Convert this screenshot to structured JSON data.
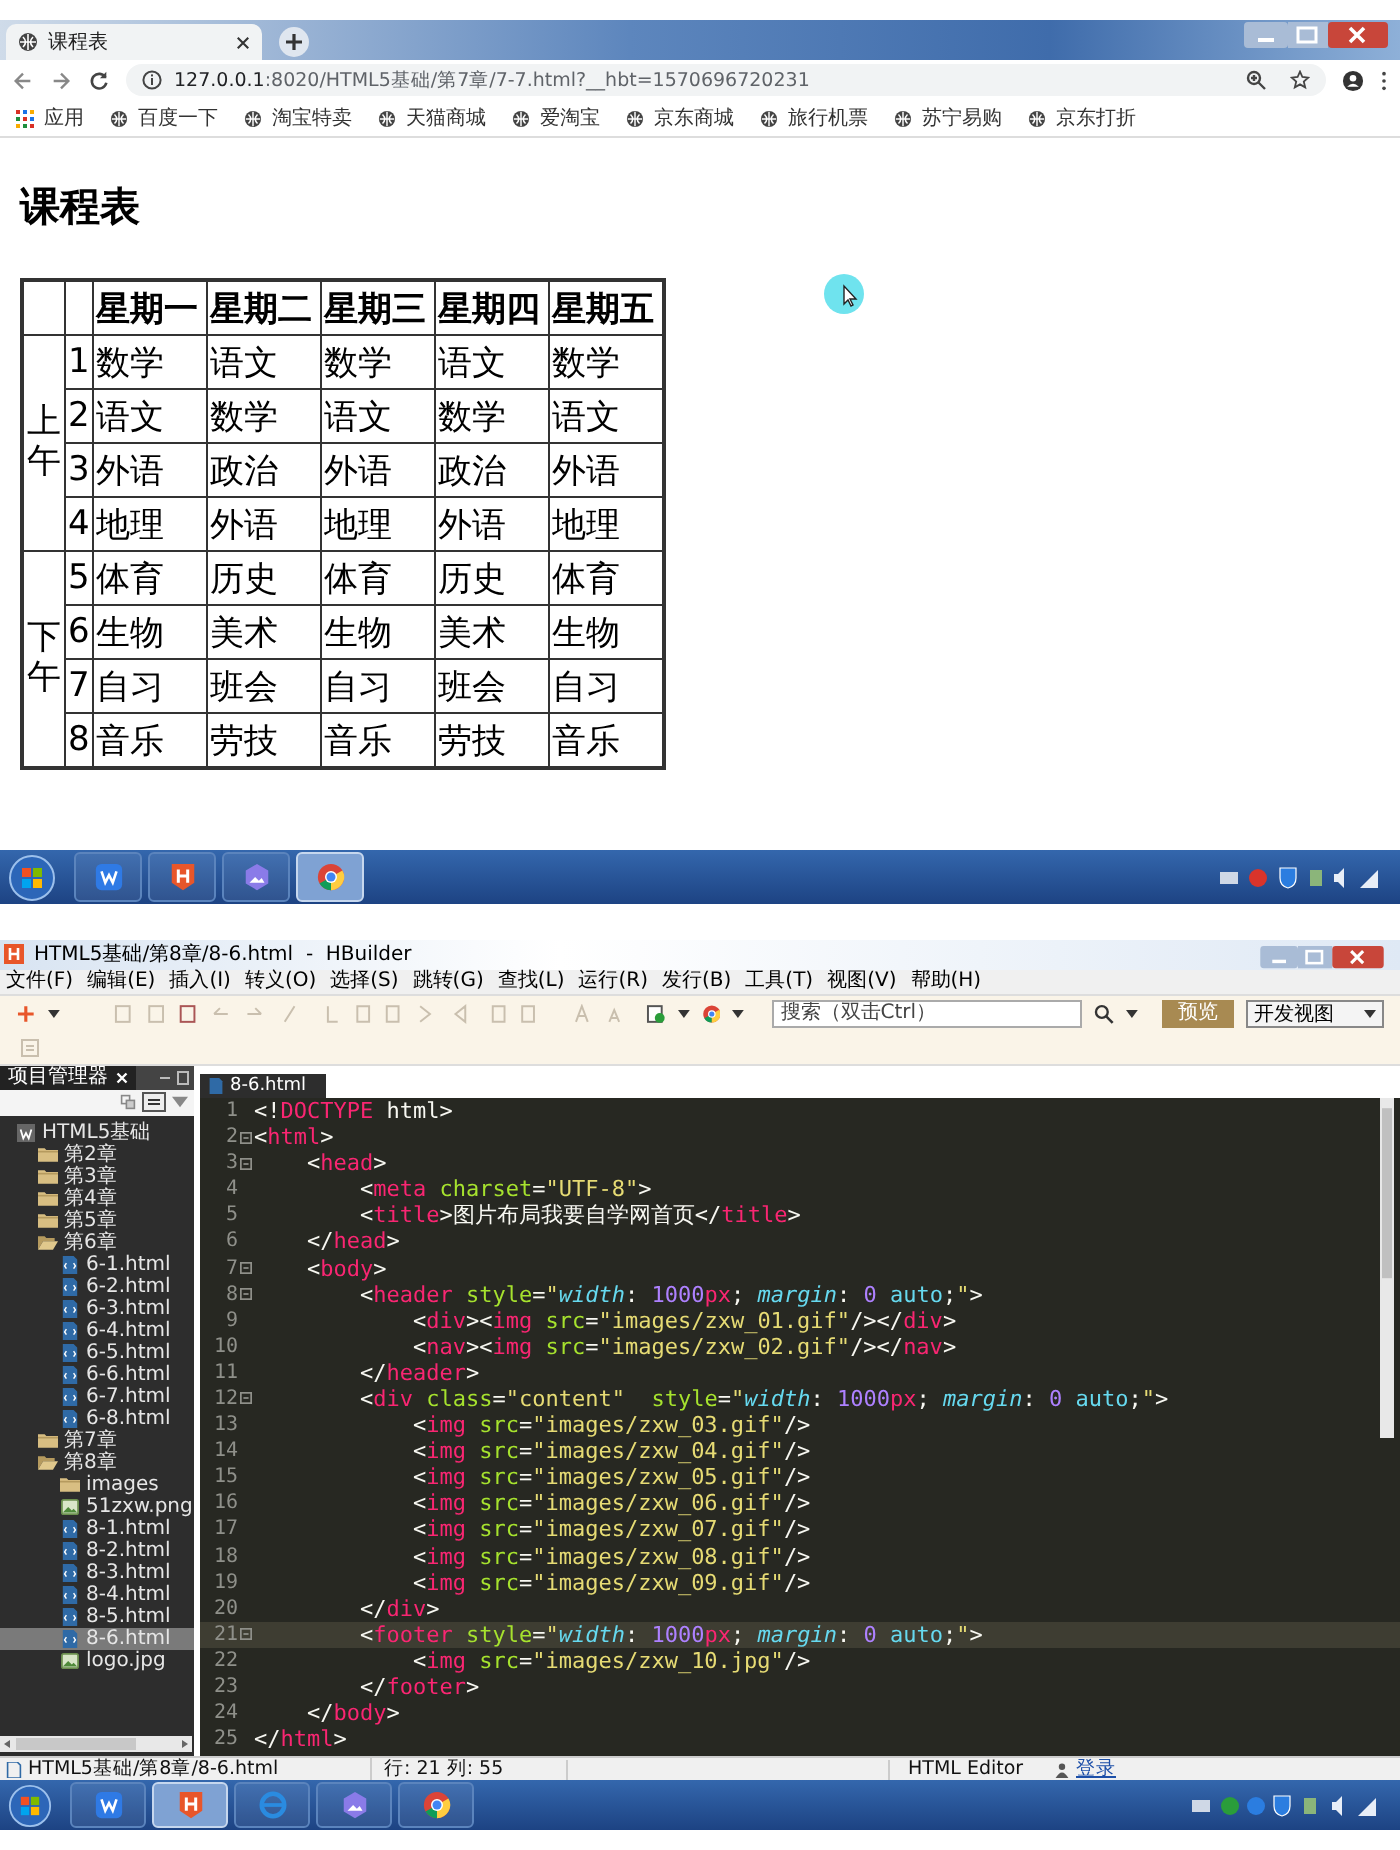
{
  "browser": {
    "tab": {
      "title": "课程表"
    },
    "url": {
      "host": "127.0.0.1",
      "path": ":8020/HTML5基础/第7章/7-7.html?__hbt=1570696720231"
    },
    "bookmarks": [
      {
        "label": "应用",
        "kind": "apps"
      },
      {
        "label": "百度一下",
        "kind": "site"
      },
      {
        "label": "淘宝特卖",
        "kind": "site"
      },
      {
        "label": "天猫商城",
        "kind": "site"
      },
      {
        "label": "爱淘宝",
        "kind": "site"
      },
      {
        "label": "京东商城",
        "kind": "site"
      },
      {
        "label": "旅行机票",
        "kind": "site"
      },
      {
        "label": "苏宁易购",
        "kind": "site"
      },
      {
        "label": "京东打折",
        "kind": "site"
      }
    ]
  },
  "page": {
    "heading": "课程表",
    "table": {
      "columns": [
        "星期一",
        "星期二",
        "星期三",
        "星期四",
        "星期五"
      ],
      "groups": [
        {
          "label": "上午",
          "rows": [
            {
              "number": "1",
              "cells": [
                "数学",
                "语文",
                "数学",
                "语文",
                "数学"
              ]
            },
            {
              "number": "2",
              "cells": [
                "语文",
                "数学",
                "语文",
                "数学",
                "语文"
              ]
            },
            {
              "number": "3",
              "cells": [
                "外语",
                "政治",
                "外语",
                "政治",
                "外语"
              ]
            },
            {
              "number": "4",
              "cells": [
                "地理",
                "外语",
                "地理",
                "外语",
                "地理"
              ]
            }
          ]
        },
        {
          "label": "下午",
          "rows": [
            {
              "number": "5",
              "cells": [
                "体育",
                "历史",
                "体育",
                "历史",
                "体育"
              ]
            },
            {
              "number": "6",
              "cells": [
                "生物",
                "美术",
                "生物",
                "美术",
                "生物"
              ]
            },
            {
              "number": "7",
              "cells": [
                "自习",
                "班会",
                "自习",
                "班会",
                "自习"
              ]
            },
            {
              "number": "8",
              "cells": [
                "音乐",
                "劳技",
                "音乐",
                "劳技",
                "音乐"
              ]
            }
          ]
        }
      ]
    }
  },
  "taskbar_top": {
    "apps": [
      {
        "kind": "wps",
        "active": false
      },
      {
        "kind": "hbuilder",
        "active": false
      },
      {
        "kind": "photos",
        "active": false
      },
      {
        "kind": "chrome",
        "active": true
      }
    ]
  },
  "hbuilder": {
    "title": "HTML5基础/第8章/8-6.html  -  HBuilder",
    "menu": [
      "文件(F)",
      "编辑(E)",
      "插入(I)",
      "转义(O)",
      "选择(S)",
      "跳转(G)",
      "查找(L)",
      "运行(R)",
      "发行(B)",
      "工具(T)",
      "视图(V)",
      "帮助(H)"
    ],
    "search": {
      "placeholder": "搜索（双击Ctrl）"
    },
    "preview_button": "预览",
    "view_select": "开发视图",
    "project": {
      "title": "项目管理器",
      "tree": [
        {
          "label": "HTML5基础",
          "kind": "project",
          "expanded": true,
          "selected": false,
          "children": [
            {
              "label": "第2章",
              "kind": "folder",
              "expanded": false,
              "selected": false
            },
            {
              "label": "第3章",
              "kind": "folder",
              "expanded": false,
              "selected": false
            },
            {
              "label": "第4章",
              "kind": "folder",
              "expanded": false,
              "selected": false
            },
            {
              "label": "第5章",
              "kind": "folder",
              "expanded": false,
              "selected": false
            },
            {
              "label": "第6章",
              "kind": "folder",
              "expanded": true,
              "selected": false,
              "children": [
                {
                  "label": "6-1.html",
                  "kind": "html",
                  "selected": false
                },
                {
                  "label": "6-2.html",
                  "kind": "html",
                  "selected": false
                },
                {
                  "label": "6-3.html",
                  "kind": "html",
                  "selected": false
                },
                {
                  "label": "6-4.html",
                  "kind": "html",
                  "selected": false
                },
                {
                  "label": "6-5.html",
                  "kind": "html",
                  "selected": false
                },
                {
                  "label": "6-6.html",
                  "kind": "html",
                  "selected": false
                },
                {
                  "label": "6-7.html",
                  "kind": "html",
                  "selected": false
                },
                {
                  "label": "6-8.html",
                  "kind": "html",
                  "selected": false
                }
              ]
            },
            {
              "label": "第7章",
              "kind": "folder",
              "expanded": false,
              "selected": false
            },
            {
              "label": "第8章",
              "kind": "folder",
              "expanded": true,
              "selected": false,
              "children": [
                {
                  "label": "images",
                  "kind": "folder",
                  "expanded": false,
                  "selected": false
                },
                {
                  "label": "51zxw.png",
                  "kind": "image",
                  "selected": false
                },
                {
                  "label": "8-1.html",
                  "kind": "html",
                  "selected": false
                },
                {
                  "label": "8-2.html",
                  "kind": "html",
                  "selected": false
                },
                {
                  "label": "8-3.html",
                  "kind": "html",
                  "selected": false
                },
                {
                  "label": "8-4.html",
                  "kind": "html",
                  "selected": false
                },
                {
                  "label": "8-5.html",
                  "kind": "html",
                  "selected": false
                },
                {
                  "label": "8-6.html",
                  "kind": "html",
                  "selected": true
                },
                {
                  "label": "logo.jpg",
                  "kind": "image",
                  "selected": false
                }
              ]
            }
          ]
        }
      ]
    },
    "editor": {
      "tab": "8-6.html",
      "lines": [
        {
          "number": "1",
          "fold": false,
          "current": false,
          "segments": [
            {
              "kind": "p",
              "text": "<!"
            },
            {
              "kind": "tag",
              "text": "DOCTYPE"
            },
            {
              "kind": "p",
              "text": " html>"
            }
          ]
        },
        {
          "number": "2",
          "fold": true,
          "current": false,
          "segments": [
            {
              "kind": "p",
              "text": "<"
            },
            {
              "kind": "tag",
              "text": "html"
            },
            {
              "kind": "p",
              "text": ">"
            }
          ]
        },
        {
          "number": "3",
          "fold": true,
          "current": false,
          "segments": [
            {
              "kind": "p",
              "text": "    <"
            },
            {
              "kind": "tag",
              "text": "head"
            },
            {
              "kind": "p",
              "text": ">"
            }
          ]
        },
        {
          "number": "4",
          "fold": false,
          "current": false,
          "segments": [
            {
              "kind": "p",
              "text": "        <"
            },
            {
              "kind": "tag",
              "text": "meta"
            },
            {
              "kind": "attr",
              "text": " charset"
            },
            {
              "kind": "p",
              "text": "="
            },
            {
              "kind": "str",
              "text": "\"UTF-8\""
            },
            {
              "kind": "p",
              "text": ">"
            }
          ]
        },
        {
          "number": "5",
          "fold": false,
          "current": false,
          "segments": [
            {
              "kind": "p",
              "text": "        <"
            },
            {
              "kind": "tag",
              "text": "title"
            },
            {
              "kind": "p",
              "text": ">图片布局我要自学网首页</"
            },
            {
              "kind": "tag",
              "text": "title"
            },
            {
              "kind": "p",
              "text": ">"
            }
          ]
        },
        {
          "number": "6",
          "fold": false,
          "current": false,
          "segments": [
            {
              "kind": "p",
              "text": "    </"
            },
            {
              "kind": "tag",
              "text": "head"
            },
            {
              "kind": "p",
              "text": ">"
            }
          ]
        },
        {
          "number": "7",
          "fold": true,
          "current": false,
          "segments": [
            {
              "kind": "p",
              "text": "    <"
            },
            {
              "kind": "tag",
              "text": "body"
            },
            {
              "kind": "p",
              "text": ">"
            }
          ]
        },
        {
          "number": "8",
          "fold": true,
          "current": false,
          "segments": [
            {
              "kind": "p",
              "text": "        <"
            },
            {
              "kind": "tag",
              "text": "header"
            },
            {
              "kind": "attr",
              "text": " style"
            },
            {
              "kind": "p",
              "text": "="
            },
            {
              "kind": "str",
              "text": "\""
            },
            {
              "kind": "prop",
              "text": "width"
            },
            {
              "kind": "p",
              "text": ": "
            },
            {
              "kind": "num",
              "text": "1000"
            },
            {
              "kind": "unit",
              "text": "px"
            },
            {
              "kind": "p",
              "text": "; "
            },
            {
              "kind": "prop",
              "text": "margin"
            },
            {
              "kind": "p",
              "text": ": "
            },
            {
              "kind": "num",
              "text": "0"
            },
            {
              "kind": "val",
              "text": " auto"
            },
            {
              "kind": "p",
              "text": ";"
            },
            {
              "kind": "str",
              "text": "\""
            },
            {
              "kind": "p",
              "text": ">"
            }
          ]
        },
        {
          "number": "9",
          "fold": false,
          "current": false,
          "segments": [
            {
              "kind": "p",
              "text": "            <"
            },
            {
              "kind": "tag",
              "text": "div"
            },
            {
              "kind": "p",
              "text": "><"
            },
            {
              "kind": "tag",
              "text": "img"
            },
            {
              "kind": "attr",
              "text": " src"
            },
            {
              "kind": "p",
              "text": "="
            },
            {
              "kind": "str",
              "text": "\"images/zxw_01.gif\""
            },
            {
              "kind": "p",
              "text": "/></"
            },
            {
              "kind": "tag",
              "text": "div"
            },
            {
              "kind": "p",
              "text": ">"
            }
          ]
        },
        {
          "number": "10",
          "fold": false,
          "current": false,
          "segments": [
            {
              "kind": "p",
              "text": "            <"
            },
            {
              "kind": "tag",
              "text": "nav"
            },
            {
              "kind": "p",
              "text": "><"
            },
            {
              "kind": "tag",
              "text": "img"
            },
            {
              "kind": "attr",
              "text": " src"
            },
            {
              "kind": "p",
              "text": "="
            },
            {
              "kind": "str",
              "text": "\"images/zxw_02.gif\""
            },
            {
              "kind": "p",
              "text": "/></"
            },
            {
              "kind": "tag",
              "text": "nav"
            },
            {
              "kind": "p",
              "text": ">"
            }
          ]
        },
        {
          "number": "11",
          "fold": false,
          "current": false,
          "segments": [
            {
              "kind": "p",
              "text": "        </"
            },
            {
              "kind": "tag",
              "text": "header"
            },
            {
              "kind": "p",
              "text": ">"
            }
          ]
        },
        {
          "number": "12",
          "fold": true,
          "current": false,
          "segments": [
            {
              "kind": "p",
              "text": "        <"
            },
            {
              "kind": "tag",
              "text": "div"
            },
            {
              "kind": "attr",
              "text": " class"
            },
            {
              "kind": "p",
              "text": "="
            },
            {
              "kind": "str",
              "text": "\"content\""
            },
            {
              "kind": "attr",
              "text": "  style"
            },
            {
              "kind": "p",
              "text": "="
            },
            {
              "kind": "str",
              "text": "\""
            },
            {
              "kind": "prop",
              "text": "width"
            },
            {
              "kind": "p",
              "text": ": "
            },
            {
              "kind": "num",
              "text": "1000"
            },
            {
              "kind": "unit",
              "text": "px"
            },
            {
              "kind": "p",
              "text": "; "
            },
            {
              "kind": "prop",
              "text": "margin"
            },
            {
              "kind": "p",
              "text": ": "
            },
            {
              "kind": "num",
              "text": "0"
            },
            {
              "kind": "val",
              "text": " auto"
            },
            {
              "kind": "p",
              "text": ";"
            },
            {
              "kind": "str",
              "text": "\""
            },
            {
              "kind": "p",
              "text": ">"
            }
          ]
        },
        {
          "number": "13",
          "fold": false,
          "current": false,
          "segments": [
            {
              "kind": "p",
              "text": "            <"
            },
            {
              "kind": "tag",
              "text": "img"
            },
            {
              "kind": "attr",
              "text": " src"
            },
            {
              "kind": "p",
              "text": "="
            },
            {
              "kind": "str",
              "text": "\"images/zxw_03.gif\""
            },
            {
              "kind": "p",
              "text": "/>"
            }
          ]
        },
        {
          "number": "14",
          "fold": false,
          "current": false,
          "segments": [
            {
              "kind": "p",
              "text": "            <"
            },
            {
              "kind": "tag",
              "text": "img"
            },
            {
              "kind": "attr",
              "text": " src"
            },
            {
              "kind": "p",
              "text": "="
            },
            {
              "kind": "str",
              "text": "\"images/zxw_04.gif\""
            },
            {
              "kind": "p",
              "text": "/>"
            }
          ]
        },
        {
          "number": "15",
          "fold": false,
          "current": false,
          "segments": [
            {
              "kind": "p",
              "text": "            <"
            },
            {
              "kind": "tag",
              "text": "img"
            },
            {
              "kind": "attr",
              "text": " src"
            },
            {
              "kind": "p",
              "text": "="
            },
            {
              "kind": "str",
              "text": "\"images/zxw_05.gif\""
            },
            {
              "kind": "p",
              "text": "/>"
            }
          ]
        },
        {
          "number": "16",
          "fold": false,
          "current": false,
          "segments": [
            {
              "kind": "p",
              "text": "            <"
            },
            {
              "kind": "tag",
              "text": "img"
            },
            {
              "kind": "attr",
              "text": " src"
            },
            {
              "kind": "p",
              "text": "="
            },
            {
              "kind": "str",
              "text": "\"images/zxw_06.gif\""
            },
            {
              "kind": "p",
              "text": "/>"
            }
          ]
        },
        {
          "number": "17",
          "fold": false,
          "current": false,
          "segments": [
            {
              "kind": "p",
              "text": "            <"
            },
            {
              "kind": "tag",
              "text": "img"
            },
            {
              "kind": "attr",
              "text": " src"
            },
            {
              "kind": "p",
              "text": "="
            },
            {
              "kind": "str",
              "text": "\"images/zxw_07.gif\""
            },
            {
              "kind": "p",
              "text": "/>"
            }
          ]
        },
        {
          "number": "18",
          "fold": false,
          "current": false,
          "segments": [
            {
              "kind": "p",
              "text": "            <"
            },
            {
              "kind": "tag",
              "text": "img"
            },
            {
              "kind": "attr",
              "text": " src"
            },
            {
              "kind": "p",
              "text": "="
            },
            {
              "kind": "str",
              "text": "\"images/zxw_08.gif\""
            },
            {
              "kind": "p",
              "text": "/>"
            }
          ]
        },
        {
          "number": "19",
          "fold": false,
          "current": false,
          "segments": [
            {
              "kind": "p",
              "text": "            <"
            },
            {
              "kind": "tag",
              "text": "img"
            },
            {
              "kind": "attr",
              "text": " src"
            },
            {
              "kind": "p",
              "text": "="
            },
            {
              "kind": "str",
              "text": "\"images/zxw_09.gif\""
            },
            {
              "kind": "p",
              "text": "/>"
            }
          ]
        },
        {
          "number": "20",
          "fold": false,
          "current": false,
          "segments": [
            {
              "kind": "p",
              "text": "        </"
            },
            {
              "kind": "tag",
              "text": "div"
            },
            {
              "kind": "p",
              "text": ">"
            }
          ]
        },
        {
          "number": "21",
          "fold": true,
          "current": true,
          "segments": [
            {
              "kind": "p",
              "text": "        <"
            },
            {
              "kind": "tag",
              "text": "footer"
            },
            {
              "kind": "attr",
              "text": " style"
            },
            {
              "kind": "p",
              "text": "="
            },
            {
              "kind": "str",
              "text": "\""
            },
            {
              "kind": "prop",
              "text": "width"
            },
            {
              "kind": "p",
              "text": ": "
            },
            {
              "kind": "num",
              "text": "1000"
            },
            {
              "kind": "unit",
              "text": "px"
            },
            {
              "kind": "p",
              "text": "; "
            },
            {
              "kind": "prop",
              "text": "margin"
            },
            {
              "kind": "p",
              "text": ": "
            },
            {
              "kind": "num",
              "text": "0"
            },
            {
              "kind": "val",
              "text": " auto"
            },
            {
              "kind": "p",
              "text": ";"
            },
            {
              "kind": "str",
              "text": "\""
            },
            {
              "kind": "p",
              "text": ">"
            }
          ]
        },
        {
          "number": "22",
          "fold": false,
          "current": false,
          "segments": [
            {
              "kind": "p",
              "text": "            <"
            },
            {
              "kind": "tag",
              "text": "img"
            },
            {
              "kind": "attr",
              "text": " src"
            },
            {
              "kind": "p",
              "text": "="
            },
            {
              "kind": "str",
              "text": "\"images/zxw_10.jpg\""
            },
            {
              "kind": "p",
              "text": "/>"
            }
          ]
        },
        {
          "number": "23",
          "fold": false,
          "current": false,
          "segments": [
            {
              "kind": "p",
              "text": "        </"
            },
            {
              "kind": "tag",
              "text": "footer"
            },
            {
              "kind": "p",
              "text": ">"
            }
          ]
        },
        {
          "number": "24",
          "fold": false,
          "current": false,
          "segments": [
            {
              "kind": "p",
              "text": "    </"
            },
            {
              "kind": "tag",
              "text": "body"
            },
            {
              "kind": "p",
              "text": ">"
            }
          ]
        },
        {
          "number": "25",
          "fold": false,
          "current": false,
          "segments": [
            {
              "kind": "p",
              "text": "</"
            },
            {
              "kind": "tag",
              "text": "html"
            },
            {
              "kind": "p",
              "text": ">"
            }
          ]
        }
      ]
    },
    "status": {
      "file": "HTML5基础/第8章/8-6.html",
      "position": "行: 21 列: 55",
      "mode": "HTML Editor",
      "login": "登录"
    }
  },
  "taskbar_bottom": {
    "apps": [
      {
        "kind": "wps",
        "active": false
      },
      {
        "kind": "hbuilder",
        "active": true
      },
      {
        "kind": "ie",
        "active": false
      },
      {
        "kind": "photos",
        "active": false
      },
      {
        "kind": "chrome",
        "active": false
      }
    ]
  }
}
